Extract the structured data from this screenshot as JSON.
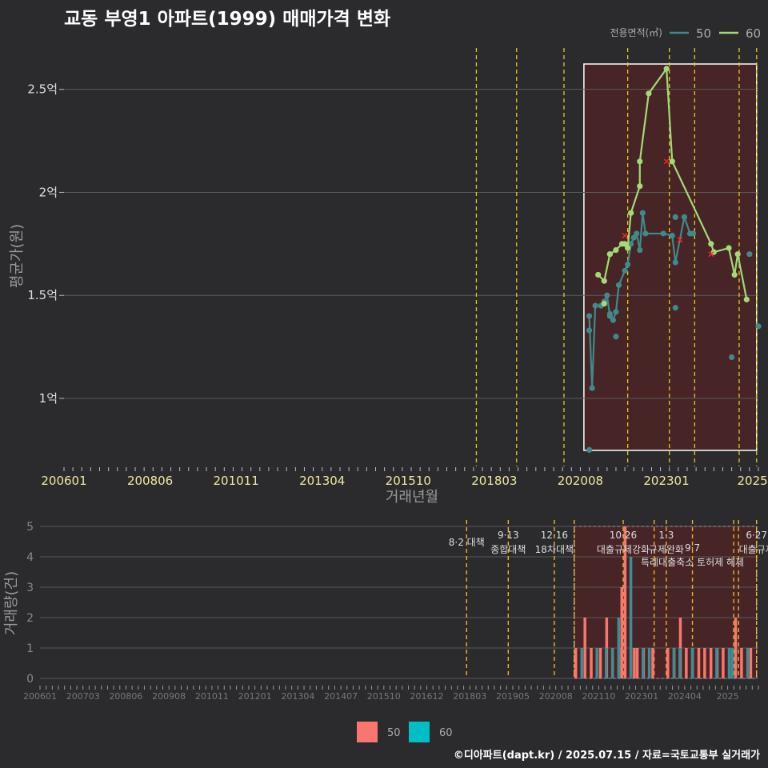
{
  "title": "교동 부영1 아파트(1999) 매매가격 변화",
  "footer": "©디아파트(dapt.kr) / 2025.07.15 / 자료=국토교통부 실거래가",
  "colors": {
    "line50": "#3f8a8c",
    "line60": "#a3d977",
    "bar50": "#f8766d",
    "bar60": "#00bfc4",
    "vline": "#e6c81f",
    "zone": "#4a2326",
    "marker": "#ff2020"
  },
  "chart_data": [
    {
      "type": "line",
      "ylabel": "평균가(원)",
      "xlabel": "거래년월",
      "ylim": [
        0.67,
        2.72
      ],
      "yticks": [
        {
          "v": 1,
          "label": "1억"
        },
        {
          "v": 1.5,
          "label": "1.5억"
        },
        {
          "v": 2,
          "label": "2억"
        },
        {
          "v": 2.5,
          "label": "2.5억"
        }
      ],
      "xticks": [
        "200601",
        "200806",
        "201011",
        "201304",
        "201510",
        "201803",
        "202008",
        "202301",
        "2025"
      ],
      "legend": {
        "title": "전용면적(㎡)",
        "entries": [
          "50",
          "60"
        ],
        "position": "top-right"
      },
      "policy_dates": [
        2017.58,
        2018.71,
        2020.04,
        2021.83,
        2023.0,
        2023.71,
        2024.96,
        2025.45
      ],
      "highlight_range": [
        2020.6,
        2025.45
      ],
      "series": [
        {
          "name": "50",
          "points": [
            [
              2020.75,
              1.4
            ],
            [
              2020.83,
              1.05
            ],
            [
              2020.92,
              1.45
            ],
            [
              2021.08,
              1.45
            ],
            [
              2021.17,
              1.47
            ],
            [
              2021.25,
              1.5
            ],
            [
              2021.33,
              1.4
            ],
            [
              2021.42,
              1.38
            ],
            [
              2021.5,
              1.42
            ],
            [
              2021.58,
              1.55
            ],
            [
              2021.75,
              1.62
            ],
            [
              2021.83,
              1.65
            ],
            [
              2021.92,
              1.75
            ],
            [
              2022.0,
              1.78
            ],
            [
              2022.08,
              1.8
            ],
            [
              2022.17,
              1.72
            ],
            [
              2022.25,
              1.9
            ],
            [
              2022.33,
              1.8
            ],
            [
              2022.83,
              1.8
            ],
            [
              2023.08,
              1.79
            ],
            [
              2023.17,
              1.66
            ],
            [
              2023.42,
              1.88
            ],
            [
              2023.58,
              1.8
            ],
            [
              2023.67,
              1.8
            ]
          ],
          "dots": [
            [
              2020.75,
              0.75
            ],
            [
              2020.75,
              1.33
            ],
            [
              2021.33,
              1.41
            ],
            [
              2021.5,
              1.3
            ],
            [
              2023.17,
              1.88
            ],
            [
              2023.17,
              1.44
            ],
            [
              2024.75,
              1.2
            ],
            [
              2025.25,
              1.7
            ],
            [
              2025.5,
              1.35
            ]
          ]
        },
        {
          "name": "60",
          "points": [
            [
              2021.0,
              1.6
            ],
            [
              2021.17,
              1.57
            ],
            [
              2021.33,
              1.7
            ],
            [
              2021.5,
              1.72
            ],
            [
              2021.67,
              1.75
            ],
            [
              2021.83,
              1.73
            ],
            [
              2021.92,
              1.9
            ],
            [
              2022.17,
              2.03
            ],
            [
              2022.17,
              2.15
            ],
            [
              2022.42,
              2.48
            ],
            [
              2022.92,
              2.6
            ],
            [
              2023.08,
              2.15
            ],
            [
              2024.17,
              1.75
            ],
            [
              2024.25,
              1.71
            ],
            [
              2024.67,
              1.73
            ],
            [
              2024.83,
              1.6
            ],
            [
              2024.92,
              1.7
            ],
            [
              2025.17,
              1.48
            ]
          ],
          "dots": [
            [
              2021.17,
              1.46
            ],
            [
              2021.33,
              1.7
            ],
            [
              2021.75,
              1.75
            ]
          ]
        }
      ],
      "cancelled_markers": [
        [
          2021.75,
          1.79
        ],
        [
          2022.92,
          2.15
        ],
        [
          2023.3,
          1.77
        ],
        [
          2024.17,
          1.7
        ]
      ]
    },
    {
      "type": "bar",
      "ylabel": "거래량(건)",
      "ylim": [
        0,
        5
      ],
      "yticks": [
        0,
        1,
        2,
        3,
        4,
        5
      ],
      "xticks": [
        "200601",
        "200703",
        "200806",
        "200908",
        "201011",
        "201201",
        "201304",
        "201407",
        "201510",
        "201612",
        "201803",
        "201905",
        "202008",
        "202110",
        "202301",
        "202404",
        "2025"
      ],
      "legend": {
        "entries": [
          "50",
          "60"
        ],
        "position": "bottom"
      },
      "policy_dates": [
        2017.58,
        2018.71,
        2019.96,
        2020.5,
        2021.83,
        2022.67,
        2023.0,
        2023.71,
        2024.83,
        2024.96,
        2025.45
      ],
      "policy_labels": [
        {
          "x": 2017.58,
          "l1": "",
          "l2": "8·2 대책"
        },
        {
          "x": 2018.71,
          "l1": "9·13",
          "l2": "종합대책"
        },
        {
          "x": 2019.96,
          "l1": "12·16",
          "l2": "18차대책"
        },
        {
          "x": 2021.83,
          "l1": "10·26",
          "l2": "대출규제강화"
        },
        {
          "x": 2023.0,
          "l1": "1·3",
          "l2": "규제완화"
        },
        {
          "x": 2023.71,
          "l1": "",
          "l2": "9·7"
        },
        {
          "x": 2023.71,
          "l1": "",
          "l2": "특례대출축소 토허제 해제"
        },
        {
          "x": 2025.45,
          "l1": "6·27",
          "l2": "대출규제"
        }
      ],
      "highlight_range": [
        2020.5,
        2025.45
      ],
      "series": [
        {
          "name": "50",
          "bars": [
            [
              2020.58,
              1
            ],
            [
              2020.83,
              2
            ],
            [
              2021.0,
              1
            ],
            [
              2021.25,
              1
            ],
            [
              2021.42,
              2
            ],
            [
              2021.58,
              1
            ],
            [
              2021.75,
              1
            ],
            [
              2021.83,
              3
            ],
            [
              2021.92,
              5
            ],
            [
              2022.08,
              1
            ],
            [
              2022.17,
              1
            ],
            [
              2022.25,
              1
            ],
            [
              2022.42,
              1
            ],
            [
              2022.67,
              1
            ],
            [
              2023.08,
              1
            ],
            [
              2023.25,
              1
            ],
            [
              2023.42,
              2
            ],
            [
              2023.58,
              1
            ],
            [
              2023.75,
              1
            ],
            [
              2023.92,
              1
            ],
            [
              2024.08,
              1
            ],
            [
              2024.25,
              1
            ],
            [
              2024.42,
              1
            ],
            [
              2024.58,
              1
            ],
            [
              2024.92,
              2
            ],
            [
              2025.08,
              1
            ],
            [
              2025.33,
              1
            ]
          ]
        },
        {
          "name": "60",
          "bars": [
            [
              2020.67,
              1
            ],
            [
              2021.08,
              1
            ],
            [
              2021.33,
              1
            ],
            [
              2021.5,
              1
            ],
            [
              2021.67,
              2
            ],
            [
              2022.0,
              4
            ],
            [
              2022.33,
              1
            ],
            [
              2022.5,
              1
            ],
            [
              2023.17,
              1
            ],
            [
              2023.33,
              1
            ],
            [
              2023.67,
              1
            ],
            [
              2024.33,
              1
            ],
            [
              2024.67,
              1
            ],
            [
              2024.75,
              1
            ],
            [
              2025.17,
              1
            ]
          ]
        }
      ]
    }
  ]
}
